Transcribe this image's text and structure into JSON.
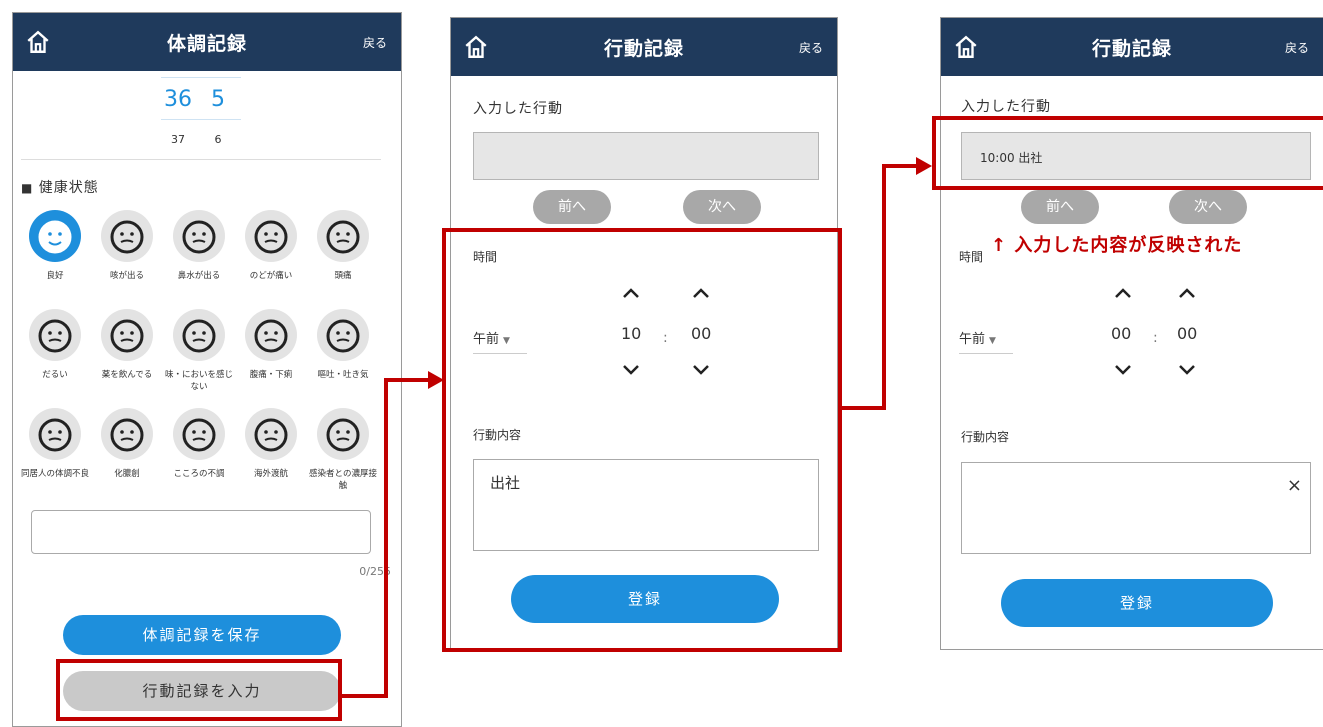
{
  "screen1": {
    "title": "体調記録",
    "back": "戻る",
    "temp_selected_int": "36",
    "temp_selected_dec": "5",
    "temp_next_int": "37",
    "temp_next_dec": "6",
    "health_heading": "健康状態",
    "conditions": [
      {
        "label": "良好",
        "icon": "smile-face-icon"
      },
      {
        "label": "咳が出る",
        "icon": "cough-face-icon"
      },
      {
        "label": "鼻水が出る",
        "icon": "runny-nose-face-icon"
      },
      {
        "label": "のどが痛い",
        "icon": "sore-throat-face-icon"
      },
      {
        "label": "頭痛",
        "icon": "headache-face-icon"
      },
      {
        "label": "だるい",
        "icon": "tired-face-icon"
      },
      {
        "label": "薬を飲んでる",
        "icon": "pill-icon"
      },
      {
        "label": "味・においを感じない",
        "icon": "no-taste-face-icon"
      },
      {
        "label": "腹痛・下痢",
        "icon": "toilet-icon"
      },
      {
        "label": "嘔吐・吐き気",
        "icon": "nausea-face-icon"
      },
      {
        "label": "同居人の体調不良",
        "icon": "sick-family-icon"
      },
      {
        "label": "化膿創",
        "icon": "first-aid-icon"
      },
      {
        "label": "こころの不調",
        "icon": "heart-hands-icon"
      },
      {
        "label": "海外渡航",
        "icon": "airplane-icon"
      },
      {
        "label": "感染者との濃厚接触",
        "icon": "group-icon"
      }
    ],
    "char_count": "0/255",
    "save_button": "体調記録を保存",
    "action_button": "行動記録を入力"
  },
  "screen2": {
    "title": "行動記録",
    "back": "戻る",
    "entered_label": "入力した行動",
    "entered_value": "",
    "prev": "前へ",
    "next": "次へ",
    "time_label": "時間",
    "ampm": "午前",
    "hour": "10",
    "colon": ":",
    "minute": "00",
    "content_label": "行動内容",
    "content_value": "出社",
    "submit": "登録"
  },
  "screen3": {
    "title": "行動記録",
    "back": "戻る",
    "entered_label": "入力した行動",
    "entered_value": "10:00 出社",
    "prev": "前へ",
    "next": "次へ",
    "note": "↑ 入力した内容が反映された",
    "time_label": "時間",
    "ampm": "午前",
    "hour": "00",
    "colon": ":",
    "minute": "00",
    "content_label": "行動内容",
    "clear": "×",
    "submit": "登録"
  },
  "colors": {
    "header": "#1f3a5c",
    "accent": "#1e8fdc",
    "highlight": "#c00000"
  }
}
